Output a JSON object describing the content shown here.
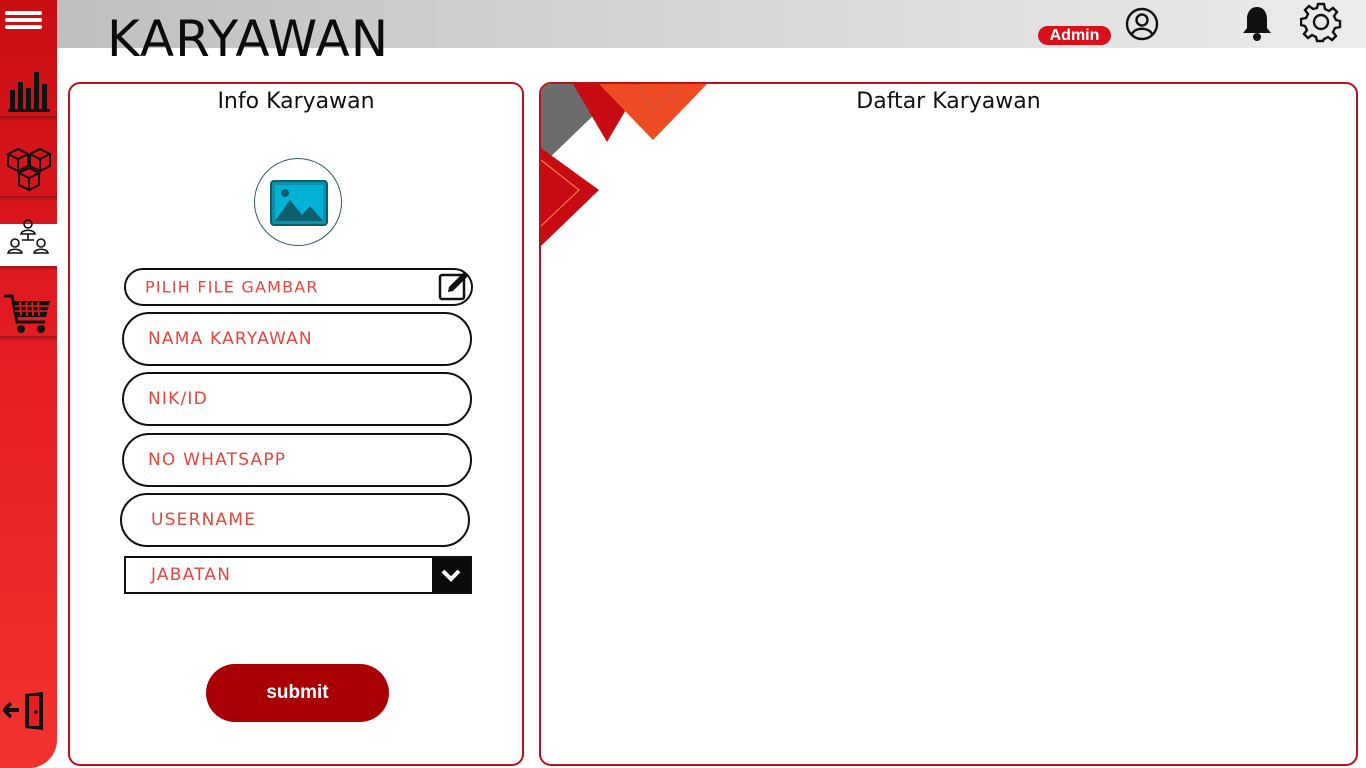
{
  "header": {
    "title": "KARYAWAN",
    "user_badge": "Admin"
  },
  "sidebar": {
    "items": [
      {
        "icon": "menu-icon"
      },
      {
        "icon": "bar-chart-icon"
      },
      {
        "icon": "boxes-icon"
      },
      {
        "icon": "people-network-icon",
        "active": true
      },
      {
        "icon": "shopping-cart-icon"
      },
      {
        "icon": "logout-icon"
      }
    ]
  },
  "info_panel": {
    "title": "Info Karyawan",
    "file_picker": "PILIH FILE GAMBAR",
    "fields": {
      "nama": "NAMA KARYAWAN",
      "nik": "NIK/ID",
      "whatsapp": "NO WHATSAPP",
      "username": "USERNAME"
    },
    "jabatan_select": "JABATAN",
    "submit_label": "submit"
  },
  "list_panel": {
    "title": "Daftar Karyawan"
  },
  "colors": {
    "accent": "#d8121b",
    "submit": "#a80005",
    "field_text": "#e8453c",
    "panel_border": "#b5121b"
  }
}
